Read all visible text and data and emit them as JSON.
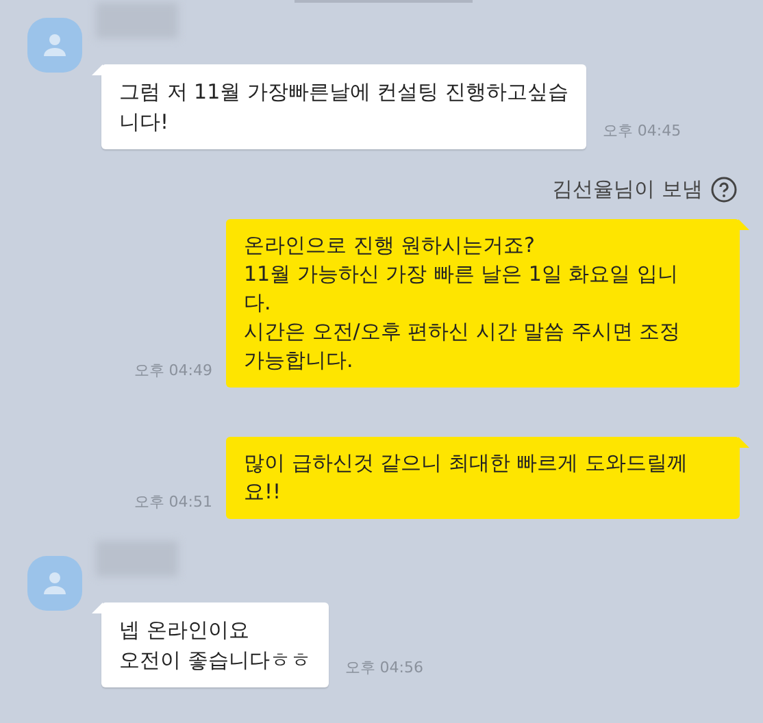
{
  "messages": [
    {
      "kind": "received",
      "text": "그럼 저 11월 가장빠른날에 컨설팅 진행하고싶습\n니다!",
      "time": "오후 04:45"
    },
    {
      "kind": "notice",
      "text": "김선율님이 보냄"
    },
    {
      "kind": "sent",
      "text": "온라인으로 진행 원하시는거죠?\n11월 가능하신 가장 빠른 날은 1일 화요일 입니\n다.\n시간은 오전/오후 편하신 시간 말씀 주시면 조정\n가능합니다.",
      "time": "오후 04:49"
    },
    {
      "kind": "sent",
      "text": "많이 급하신것 같으니 최대한 빠르게 도와드릴께\n요!!",
      "time": "오후 04:51"
    },
    {
      "kind": "received",
      "text": "넵 온라인이요\n오전이 좋습니다ㅎㅎ",
      "time": "오후 04:56"
    }
  ]
}
